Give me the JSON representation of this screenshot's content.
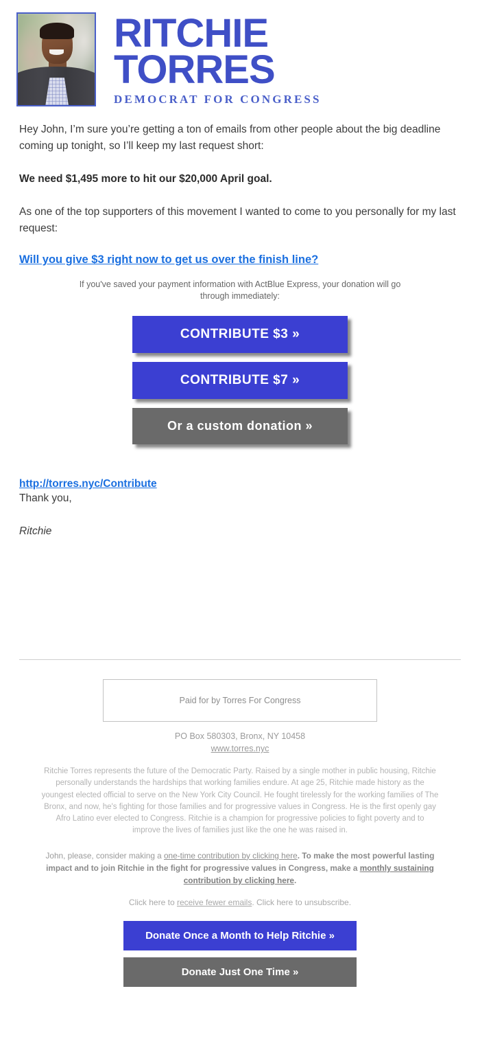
{
  "header": {
    "candidate_first": "RITCHIE",
    "candidate_last": "TORRES",
    "tagline": "DEMOCRAT FOR CONGRESS",
    "photo_alt": "Ritchie Torres headshot",
    "logo_blue": "#3f4fc6"
  },
  "body": {
    "greeting_paragraph": "Hey John, I’m sure you’re getting a ton of emails from other people about the big deadline coming up tonight, so I’ll keep my last request short:",
    "goal_paragraph": "We need $1,495 more to hit our $20,000 April goal.",
    "supporter_paragraph": "As one of the top supporters of this movement I wanted to come to you personally for my last request:",
    "ask_link": "Will you give $3 right now to get us over the finish line?",
    "express_note": "If you've saved your payment information with ActBlue Express, your donation will go through immediately:",
    "contribute_url": "http://torres.nyc/Contribute",
    "thank_you": "Thank you,",
    "signature": "Ritchie"
  },
  "buttons": {
    "contribute_3": "CONTRIBUTE $3 »",
    "contribute_7": "CONTRIBUTE $7 »",
    "custom": "Or a custom donation »",
    "blue_color": "#3b3fd2",
    "grey_color": "#6a6a6a"
  },
  "footer": {
    "paid_for_by": "Paid for by Torres For Congress",
    "address": "PO Box 580303, Bronx, NY 10458",
    "website": "www.torres.nyc",
    "bio": "Ritchie Torres represents the future of the Democratic Party. Raised by a single mother in public housing, Ritchie personally understands the hardships that working families endure. At age 25, Ritchie made history as the youngest elected official to serve on the New York City Council. He fought tirelessly for the working families of The Bronx, and now, he's fighting for those families and for progressive values in Congress. He is the first openly gay Afro Latino ever elected to Congress. Ritchie is a champion for progressive policies to fight poverty and to improve the lives of families just like the one he was raised in.",
    "cta_lead": "John, please, consider making a ",
    "cta_link_one": "one-time contribution by clicking here",
    "cta_mid": ". To make the most powerful lasting impact and to join Ritchie in the fight for progressive values in Congress, make a ",
    "cta_link_monthly": "monthly sustaining contribution by clicking here",
    "cta_end": ".",
    "unsub_lead": "Click here to ",
    "unsub_link": "receive fewer emails",
    "unsub_tail": ". Click here to unsubscribe.",
    "donate_monthly_button": "Donate Once a Month to Help Ritchie »",
    "donate_once_button": "Donate Just One Time »"
  }
}
